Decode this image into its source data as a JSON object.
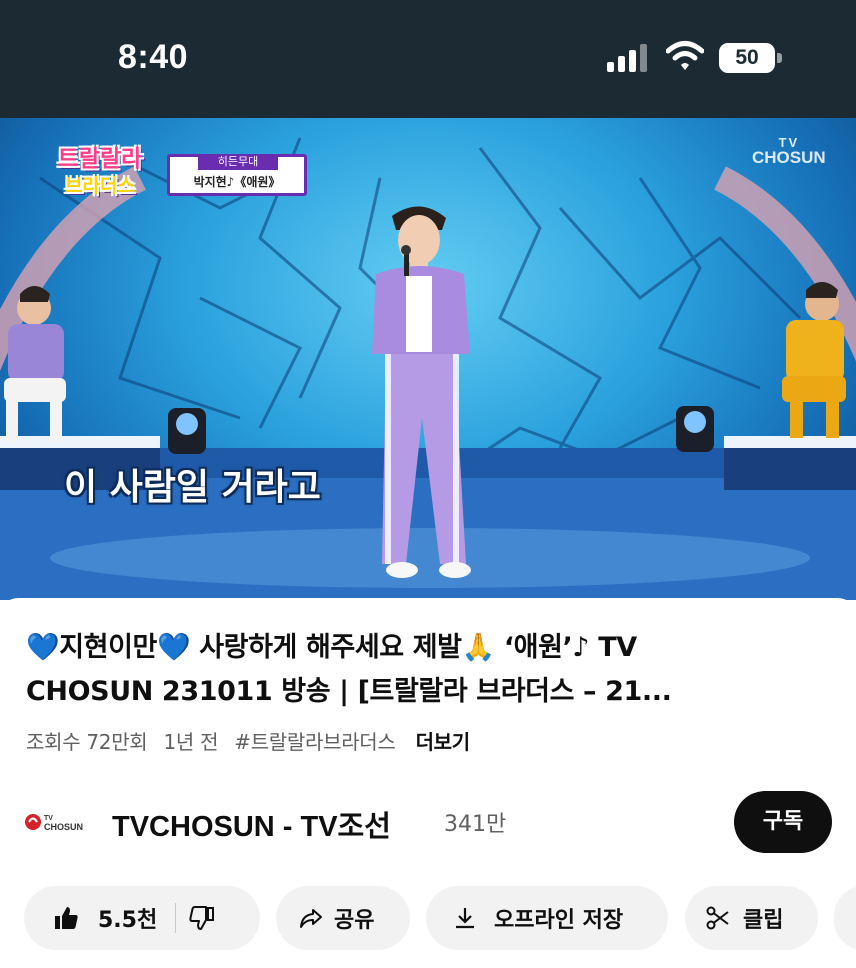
{
  "status_bar": {
    "time": "8:40",
    "battery": "50",
    "icons": [
      "cellular-signal-icon",
      "wifi-icon",
      "battery-icon"
    ]
  },
  "video": {
    "subtitle": "이 사람일 거라고",
    "broadcaster_logo_top": "TV",
    "broadcaster_logo_bottom": "CHOSUN",
    "show_logo_line1": "트랄랄라",
    "show_logo_line2": "브라더스",
    "caption_head": "히든무대",
    "caption_body": "박지현♪《애원》"
  },
  "title": {
    "line1": "💙지현이만💙 사랑하게 해주세요 제발🙏 ‘애원’♪ TV",
    "line2": "CHOSUN 231011 방송 | [트랄랄라 브라더스 – 21..."
  },
  "meta": {
    "views": "조회수 72만회",
    "age": "1년 전",
    "hashtag": "#트랄랄라브라더스",
    "more": "더보기"
  },
  "channel": {
    "logo_tv": "TV",
    "logo_chosun": "CHOSUN",
    "name": "TVCHOSUN - TV조선",
    "subscribers": "341만",
    "subscribe_label": "구독"
  },
  "actions": {
    "like_count": "5.5천",
    "share_label": "공유",
    "download_label": "오프라인 저장",
    "clip_label": "클립"
  },
  "colors": {
    "status_bar_bg": "#1c2a33",
    "subscribe_bg": "#0f0f0f",
    "pill_bg": "#f2f2f2",
    "meta_text": "#606060"
  }
}
